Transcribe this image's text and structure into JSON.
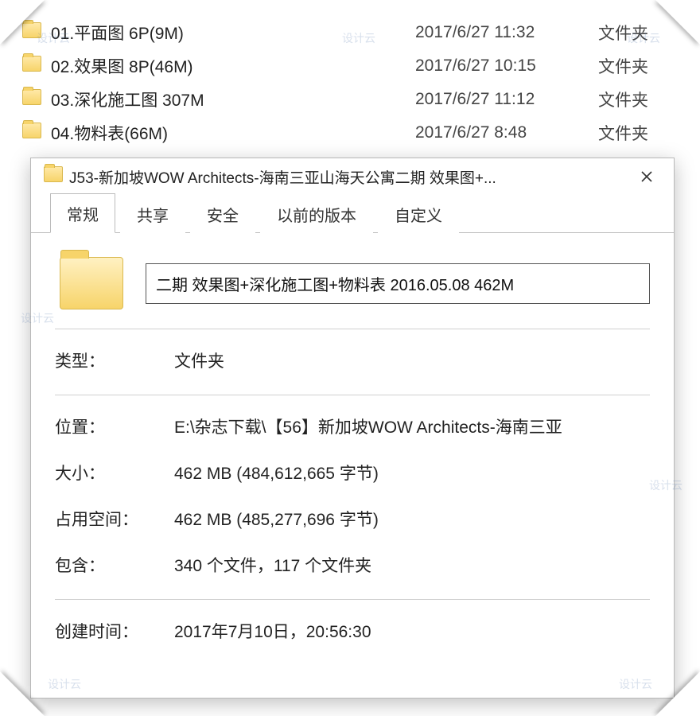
{
  "file_list": {
    "rows": [
      {
        "name": "01.平面图 6P(9M)",
        "date": "2017/6/27 11:32",
        "type": "文件夹"
      },
      {
        "name": "02.效果图 8P(46M)",
        "date": "2017/6/27 10:15",
        "type": "文件夹"
      },
      {
        "name": "03.深化施工图 307M",
        "date": "2017/6/27 11:12",
        "type": "文件夹"
      },
      {
        "name": "04.物料表(66M)",
        "date": "2017/6/27 8:48",
        "type": "文件夹"
      }
    ]
  },
  "dialog": {
    "title": "J53-新加坡WOW Architects-海南三亚山海天公寓二期 效果图+...",
    "tabs": {
      "general": "常规",
      "share": "共享",
      "security": "安全",
      "previous": "以前的版本",
      "custom": "自定义"
    },
    "name_field": "二期 效果图+深化施工图+物料表 2016.05.08 462M",
    "labels": {
      "type": "类型：",
      "location": "位置：",
      "size": "大小：",
      "size_on_disk": "占用空间：",
      "contains": "包含：",
      "created": "创建时间："
    },
    "values": {
      "type": "文件夹",
      "location": "E:\\杂志下载\\【56】新加坡WOW Architects-海南三亚",
      "size": "462 MB (484,612,665 字节)",
      "size_on_disk": "462 MB (485,277,696 字节)",
      "contains": "340 个文件，117 个文件夹",
      "created": "2017年7月10日，20:56:30"
    }
  },
  "watermark_text": "设计云"
}
